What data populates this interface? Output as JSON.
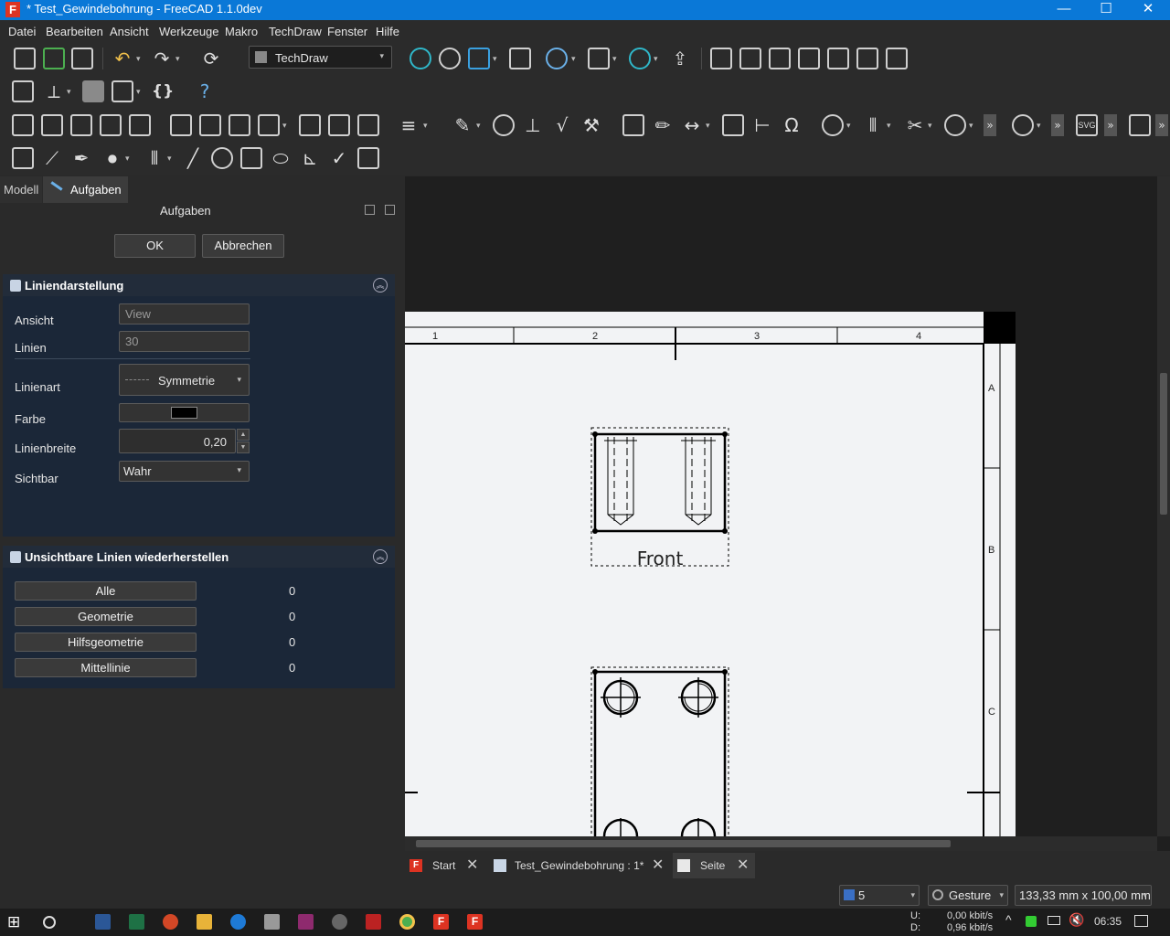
{
  "window": {
    "title": "* Test_Gewindebohrung - FreeCAD 1.1.0dev",
    "app_icon": "F",
    "controls": {
      "minimize": "—",
      "maximize": "☐",
      "close": "✕"
    }
  },
  "menubar": {
    "items": [
      "Datei",
      "Bearbeiten",
      "Ansicht",
      "Werkzeuge",
      "Makro",
      "TechDraw",
      "Fenster",
      "Hilfe"
    ]
  },
  "toolbar": {
    "workbench": "TechDraw",
    "dropdown_arrow": "▾",
    "glyphs": {
      "braces": "{}",
      "whatsthis": "?",
      "omega": "Ω",
      "svg": "SVG",
      "more": "»"
    }
  },
  "left_panel": {
    "tabs": [
      "Modell",
      "Aufgaben"
    ],
    "title": "Aufgaben",
    "ok_label": "OK",
    "cancel_label": "Abbrechen",
    "collapse_glyph": "︽",
    "line_section": {
      "title": "Liniendarstellung",
      "fields": {
        "view_label": "Ansicht",
        "view_value": "View",
        "lines_label": "Linien",
        "lines_value": "30",
        "linestyle_label": "Linienart",
        "linestyle_value": "Symmetrie",
        "color_label": "Farbe",
        "color_value": "#000000",
        "width_label": "Linienbreite",
        "width_value": "0,20",
        "visible_label": "Sichtbar",
        "visible_value": "Wahr"
      }
    },
    "restore_section": {
      "title": "Unsichtbare Linien wiederherstellen",
      "rows": [
        {
          "label": "Alle",
          "count": "0"
        },
        {
          "label": "Geometrie",
          "count": "0"
        },
        {
          "label": "Hilfsgeometrie",
          "count": "0"
        },
        {
          "label": "Mittellinie",
          "count": "0"
        }
      ]
    }
  },
  "drawing": {
    "columns": [
      "1",
      "2",
      "3",
      "4"
    ],
    "rows": [
      "A",
      "B",
      "C"
    ],
    "view_label": "Front"
  },
  "doc_tabs": [
    {
      "label": "Start"
    },
    {
      "label": "Test_Gewindebohrung : 1*"
    },
    {
      "label": "Seite"
    }
  ],
  "close_glyph": "✕",
  "statusbar": {
    "layer_value": "5",
    "navigation": "Gesture",
    "dimensions": "133,33 mm x 100,00 mm"
  },
  "taskbar": {
    "net_up_label": "U:",
    "net_up": "0,00 kbit/s",
    "net_down_label": "D:",
    "net_down": "0,96 kbit/s",
    "time": "06:35",
    "tray_chevron": "^"
  },
  "colors": {
    "titlebar": "#0a78d7",
    "panel_section": "#1b2738",
    "paper": "#f2f3f5"
  }
}
